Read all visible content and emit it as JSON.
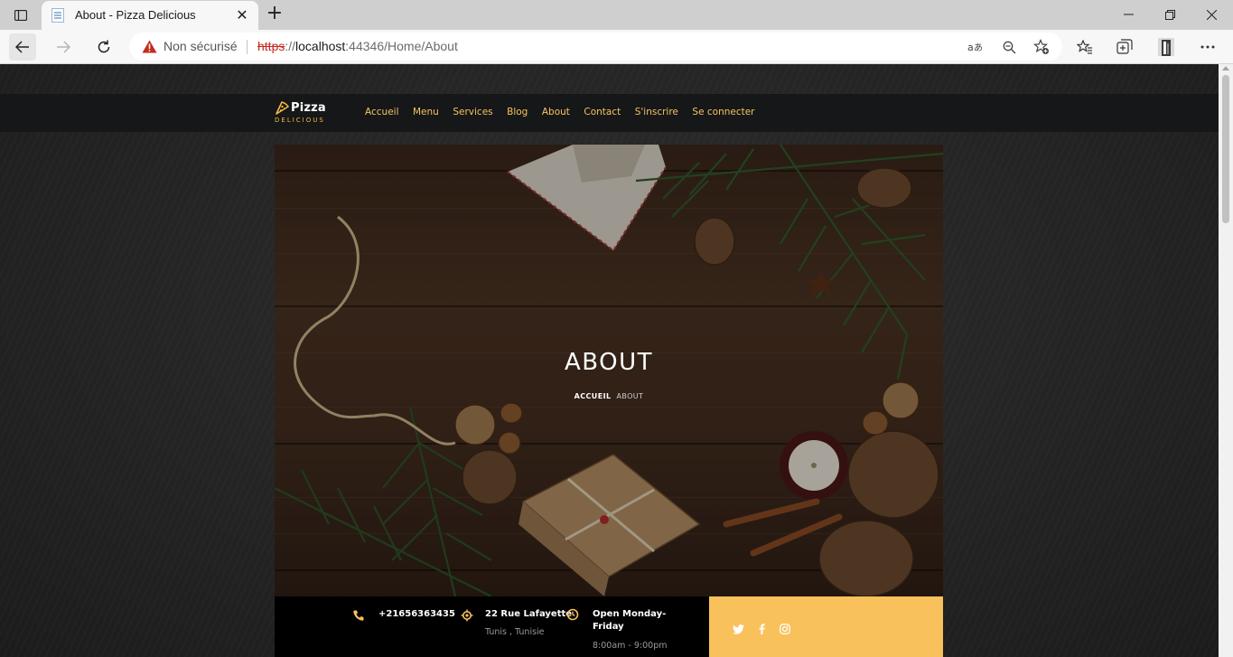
{
  "browser": {
    "tab_title": "About - Pizza Delicious",
    "tab_close": "✕",
    "new_tab": "+",
    "security_label": "Non sécurisé",
    "url_scheme": "https",
    "url_rest_prefix": "://",
    "url_host": "localhost",
    "url_path": ":44346/Home/About"
  },
  "site": {
    "logo_word": "Pizza",
    "logo_sub": "DELICIOUS",
    "nav": [
      "Accueil",
      "Menu",
      "Services",
      "Blog",
      "About",
      "Contact",
      "S'inscrire",
      "Se connecter"
    ],
    "accent_color": "#f7c35f"
  },
  "hero": {
    "title": "ABOUT",
    "breadcrumb_home": "ACCUEIL",
    "breadcrumb_current": "ABOUT"
  },
  "info": {
    "phone": "+21656363435",
    "address_line1": "22 Rue Lafayette",
    "address_line2": "Tunis , Tunisie",
    "hours_line1": "Open Monday-",
    "hours_line2": "Friday",
    "hours_line3": "8:00am - 9:00pm"
  },
  "social": [
    "twitter-icon",
    "facebook-icon",
    "instagram-icon"
  ]
}
